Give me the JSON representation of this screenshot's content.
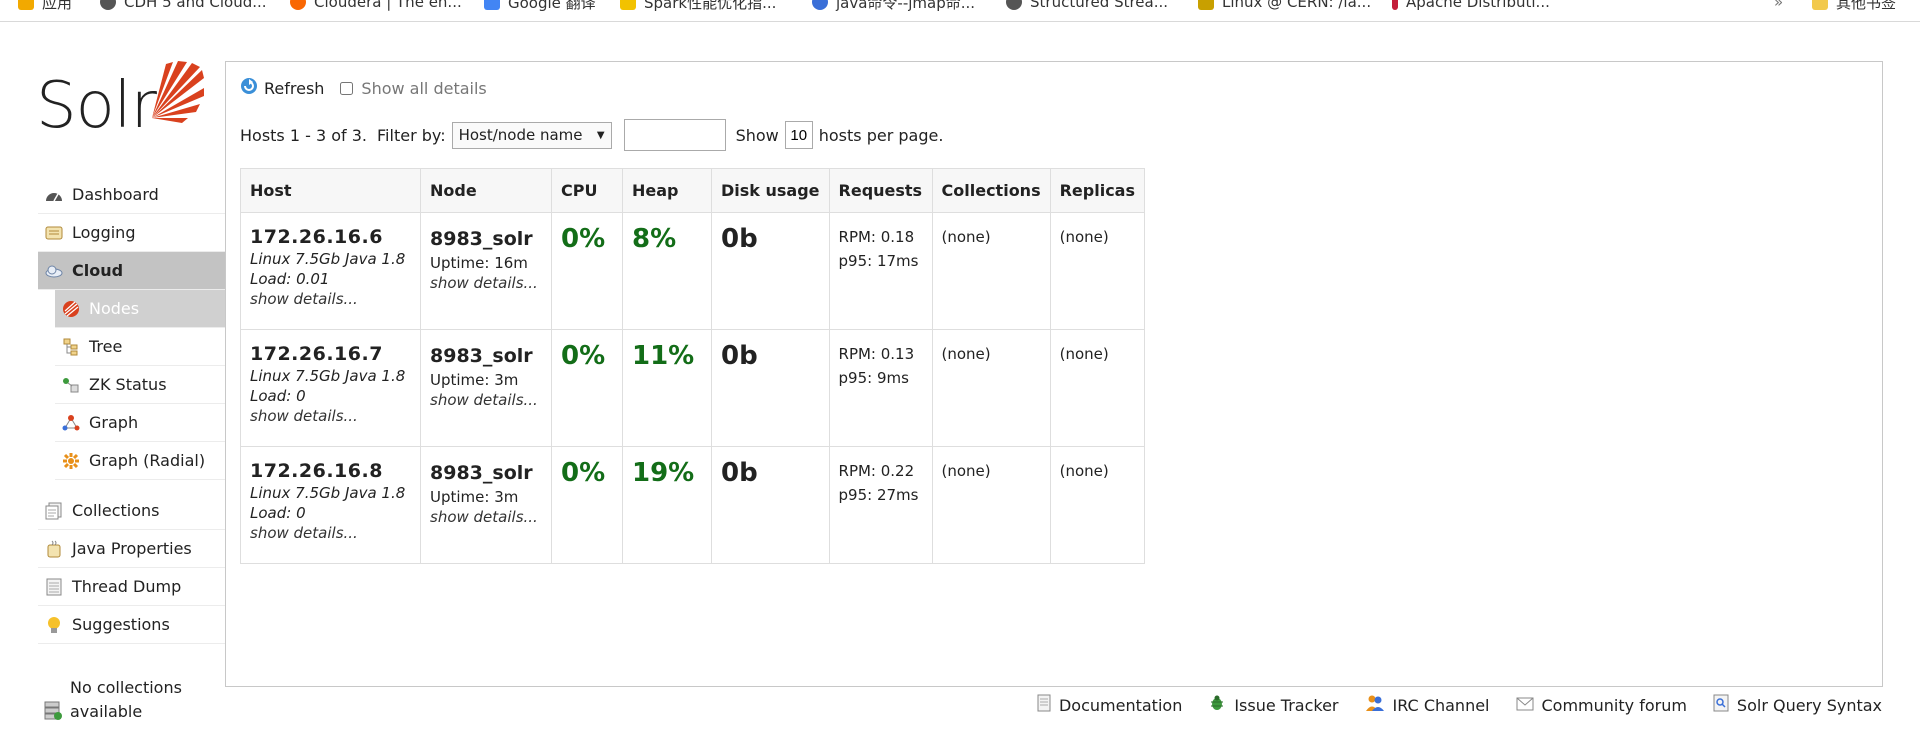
{
  "bookmarks": [
    {
      "label": "应用",
      "color": "#f2a900"
    },
    {
      "label": "CDH 5 and Cloud...",
      "color": "#555555"
    },
    {
      "label": "Cloudera | The en...",
      "color": "#f96702"
    },
    {
      "label": "Google 翻译",
      "color": "#4285f4"
    },
    {
      "label": "Spark性能优化指...",
      "color": "#f2c200"
    },
    {
      "label": "java命令--jmap命...",
      "color": "#3a6fd8"
    },
    {
      "label": "Structured Strea...",
      "color": "#555555"
    },
    {
      "label": "Linux @ CERN: /la...",
      "color": "#c8a000"
    },
    {
      "label": "Apache Distributi...",
      "color": "#c41e3a"
    },
    {
      "label": "其他书签",
      "color": "#f2c94c"
    }
  ],
  "logo": {
    "text": "Solr"
  },
  "sidebar": {
    "items": [
      {
        "label": "Dashboard",
        "icon": "dashboard-icon"
      },
      {
        "label": "Logging",
        "icon": "logging-icon"
      },
      {
        "label": "Cloud",
        "icon": "cloud-icon"
      }
    ],
    "cloud_sub": [
      {
        "label": "Nodes",
        "icon": "nodes-icon"
      },
      {
        "label": "Tree",
        "icon": "tree-icon"
      },
      {
        "label": "ZK Status",
        "icon": "zk-status-icon"
      },
      {
        "label": "Graph",
        "icon": "graph-icon"
      },
      {
        "label": "Graph (Radial)",
        "icon": "graph-radial-icon"
      }
    ],
    "lower": [
      {
        "label": "Collections",
        "icon": "collections-icon"
      },
      {
        "label": "Java Properties",
        "icon": "java-properties-icon"
      },
      {
        "label": "Thread Dump",
        "icon": "thread-dump-icon"
      },
      {
        "label": "Suggestions",
        "icon": "suggestions-icon"
      }
    ],
    "no_collections_line1": "No collections",
    "no_collections_line2": "available"
  },
  "toolbar": {
    "refresh": "Refresh",
    "show_all_details": "Show all details"
  },
  "filter": {
    "hosts_summary": "Hosts 1 - 3 of 3.",
    "filter_by": "Filter by:",
    "filter_select": "Host/node name",
    "filter_value": "",
    "show": "Show",
    "per_page_value": "10",
    "hosts_per_page": "hosts per page."
  },
  "table": {
    "headers": [
      "Host",
      "Node",
      "CPU",
      "Heap",
      "Disk usage",
      "Requests",
      "Collections",
      "Replicas"
    ],
    "rows": [
      {
        "host": "172.26.16.6",
        "os": "Linux 7.5Gb Java 1.8",
        "load": "Load: 0.01",
        "details": "show details...",
        "node": "8983_solr",
        "uptime": "Uptime: 16m",
        "node_details": "show details...",
        "cpu": "0%",
        "heap": "8%",
        "disk": "0b",
        "rpm": "RPM: 0.18",
        "p95": "p95: 17ms",
        "collections": "(none)",
        "replicas": "(none)"
      },
      {
        "host": "172.26.16.7",
        "os": "Linux 7.5Gb Java 1.8",
        "load": "Load: 0",
        "details": "show details...",
        "node": "8983_solr",
        "uptime": "Uptime: 3m",
        "node_details": "show details...",
        "cpu": "0%",
        "heap": "11%",
        "disk": "0b",
        "rpm": "RPM: 0.13",
        "p95": "p95: 9ms",
        "collections": "(none)",
        "replicas": "(none)"
      },
      {
        "host": "172.26.16.8",
        "os": "Linux 7.5Gb Java 1.8",
        "load": "Load: 0",
        "details": "show details...",
        "node": "8983_solr",
        "uptime": "Uptime: 3m",
        "node_details": "show details...",
        "cpu": "0%",
        "heap": "19%",
        "disk": "0b",
        "rpm": "RPM: 0.22",
        "p95": "p95: 27ms",
        "collections": "(none)",
        "replicas": "(none)"
      }
    ]
  },
  "footer": [
    {
      "label": "Documentation",
      "icon": "documentation-icon"
    },
    {
      "label": "Issue Tracker",
      "icon": "bug-icon"
    },
    {
      "label": "IRC Channel",
      "icon": "irc-people-icon"
    },
    {
      "label": "Community forum",
      "icon": "mail-icon"
    },
    {
      "label": "Solr Query Syntax",
      "icon": "query-syntax-icon"
    }
  ],
  "colors": {
    "metric_green": "#136d18",
    "active_nav": "#c3c3c3",
    "solr_red": "#d9411e"
  }
}
